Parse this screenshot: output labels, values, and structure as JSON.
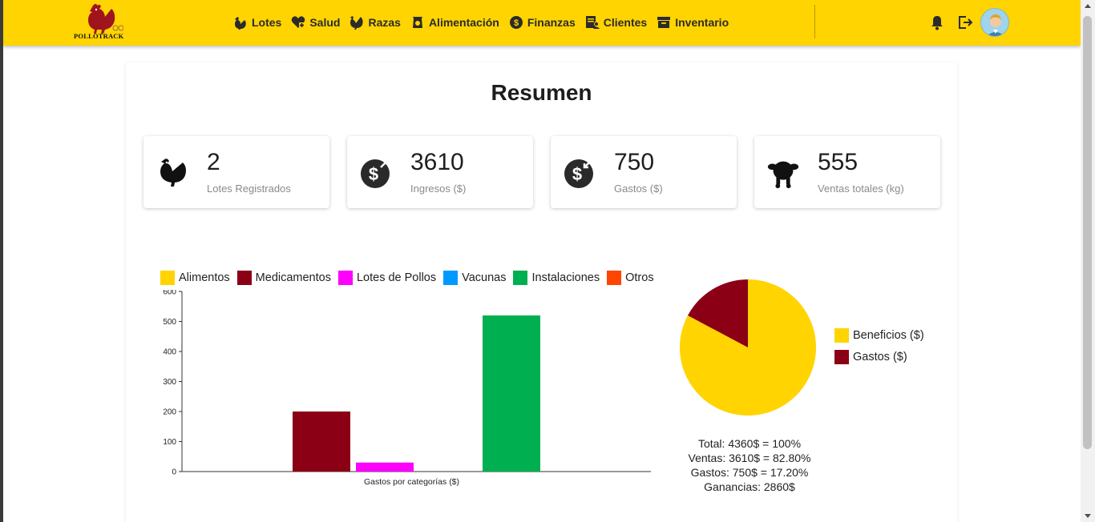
{
  "app": {
    "brand": "POLLOTRACK"
  },
  "nav": {
    "items": [
      {
        "label": "Lotes",
        "icon": "hen-icon"
      },
      {
        "label": "Salud",
        "icon": "health-heart-icon"
      },
      {
        "label": "Razas",
        "icon": "rooster-icon"
      },
      {
        "label": "Alimentación",
        "icon": "feed-bag-icon"
      },
      {
        "label": "Finanzas",
        "icon": "dollar-circle-icon"
      },
      {
        "label": "Clientes",
        "icon": "client-card-icon"
      },
      {
        "label": "Inventario",
        "icon": "archive-box-icon"
      }
    ]
  },
  "page": {
    "title": "Resumen"
  },
  "stats": [
    {
      "value": "2",
      "label": "Lotes Registrados",
      "icon": "hen-icon"
    },
    {
      "value": "3610",
      "label": "Ingresos ($)",
      "icon": "money-in-icon"
    },
    {
      "value": "750",
      "label": "Gastos ($)",
      "icon": "money-out-icon"
    },
    {
      "value": "555",
      "label": "Ventas totales (kg)",
      "icon": "roast-chicken-icon"
    }
  ],
  "colors": {
    "accent": "#ffd400",
    "alimentos": "#ffd400",
    "medicamentos": "#8b0015",
    "lotes_pollos": "#ff00ff",
    "vacunas": "#0099ff",
    "instalaciones": "#00b050",
    "otros": "#ff4500"
  },
  "chart_data": [
    {
      "type": "bar",
      "categories": [
        "Alimentos",
        "Medicamentos",
        "Lotes de Pollos",
        "Vacunas",
        "Instalaciones",
        "Otros"
      ],
      "values": [
        0,
        200,
        30,
        0,
        520,
        0
      ],
      "colors": [
        "#ffd400",
        "#8b0015",
        "#ff00ff",
        "#0099ff",
        "#00b050",
        "#ff4500"
      ],
      "xlabel": "Gastos por categorías ($)",
      "ylabel": "",
      "ylim": [
        0,
        600
      ],
      "yticks": [
        0,
        100,
        200,
        300,
        400,
        500,
        600
      ],
      "legend": "top"
    },
    {
      "type": "pie",
      "labels": [
        "Beneficios ($)",
        "Gastos ($)"
      ],
      "values": [
        3610,
        750
      ],
      "colors": [
        "#ffd400",
        "#8b0015"
      ],
      "legend": "right"
    }
  ],
  "summary": {
    "total": "Total: 4360$ = 100%",
    "ventas": "Ventas: 3610$ = 82.80%",
    "gastos": "Gastos: 750$ = 17.20%",
    "ganancias": "Ganancias: 2860$"
  }
}
